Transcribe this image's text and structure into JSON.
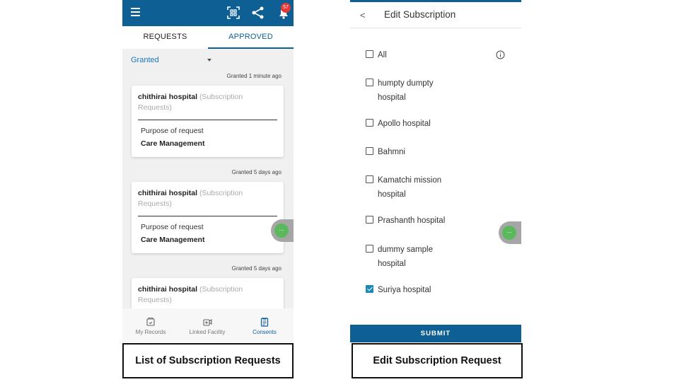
{
  "left_screen": {
    "notification_count": "57",
    "tabs": [
      {
        "label": "REQUESTS",
        "active": false
      },
      {
        "label": "APPROVED",
        "active": true
      }
    ],
    "filter": {
      "value": "Granted"
    },
    "cards": [
      {
        "timestamp": "Granted 1 minute ago",
        "hospital": "chithirai hospital",
        "type": "(Subscription Requests)",
        "purpose_label": "Purpose of request",
        "purpose_value": "Care Management"
      },
      {
        "timestamp": "Granted 5 days ago",
        "hospital": "chithirai hospital",
        "type": "(Subscription Requests)",
        "purpose_label": "Purpose of request",
        "purpose_value": "Care Management"
      },
      {
        "timestamp": "Granted 5 days ago",
        "hospital": "chithirai hospital",
        "type": "(Subscription Requests)",
        "purpose_label": "",
        "purpose_value": ""
      }
    ],
    "bottom_nav": [
      {
        "label": "My Records",
        "icon": "records-icon",
        "active": false
      },
      {
        "label": "Linked Facility",
        "icon": "facility-icon",
        "active": false
      },
      {
        "label": "Consents",
        "icon": "consents-icon",
        "active": true
      }
    ],
    "fab_label": "..."
  },
  "right_screen": {
    "title": "Edit Subscription",
    "back_glyph": "<",
    "options": [
      {
        "label": "All",
        "checked": false
      },
      {
        "label": "humpty dumpty hospital",
        "checked": false
      },
      {
        "label": "Apollo hospital",
        "checked": false
      },
      {
        "label": "Bahmni",
        "checked": false
      },
      {
        "label": "Kamatchi mission hospital",
        "checked": false
      },
      {
        "label": "Prashanth hospital",
        "checked": false
      },
      {
        "label": "dummy sample hospital",
        "checked": false
      },
      {
        "label": "Suriya hospital",
        "checked": true
      }
    ],
    "submit_label": "SUBMIT",
    "fab_label": "..."
  },
  "captions": {
    "left": "List of Subscription Requests",
    "right": "Edit Subscription Request"
  },
  "colors": {
    "brand_blue": "#0e5f94",
    "link_blue": "#1a77b8",
    "badge_red": "#e53935",
    "fab_green": "#5cb85c",
    "checkbox_checked": "#1a8ab0"
  }
}
